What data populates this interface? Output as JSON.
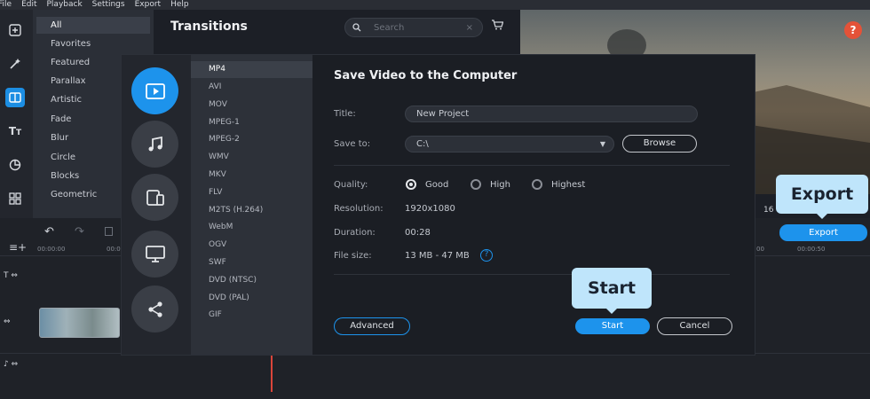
{
  "menu": [
    "File",
    "Edit",
    "Playback",
    "Settings",
    "Export",
    "Help"
  ],
  "categories": [
    "All",
    "Favorites",
    "Featured",
    "Parallax",
    "Artistic",
    "Fade",
    "Blur",
    "Circle",
    "Blocks",
    "Geometric"
  ],
  "transitions": {
    "title": "Transitions",
    "search_placeholder": "Search"
  },
  "formats": [
    "MP4",
    "AVI",
    "MOV",
    "MPEG-1",
    "MPEG-2",
    "WMV",
    "MKV",
    "FLV",
    "M2TS (H.264)",
    "WebM",
    "OGV",
    "SWF",
    "DVD (NTSC)",
    "DVD (PAL)",
    "GIF"
  ],
  "dialog": {
    "title": "Save Video to the Computer",
    "title_label": "Title:",
    "title_value": "New Project",
    "save_to_label": "Save to:",
    "save_to_value": "C:\\",
    "browse_label": "Browse",
    "quality_label": "Quality:",
    "quality_options": [
      "Good",
      "High",
      "Highest"
    ],
    "resolution_label": "Resolution:",
    "resolution_value": "1920x1080",
    "duration_label": "Duration:",
    "duration_value": "00:28",
    "filesize_label": "File size:",
    "filesize_value": "13 MB - 47 MB",
    "advanced_label": "Advanced",
    "start_label": "Start",
    "cancel_label": "Cancel"
  },
  "export_button": "Export",
  "callouts": {
    "export": "Export",
    "start": "Start"
  },
  "timeline": {
    "ruler_left": [
      "00:00:00",
      "00:0"
    ],
    "ruler_right": [
      "00",
      "00:00:50"
    ],
    "counter": "16"
  },
  "colors": {
    "accent": "#1d93ec",
    "callout": "#bfe5fb",
    "help": "#e45238"
  }
}
